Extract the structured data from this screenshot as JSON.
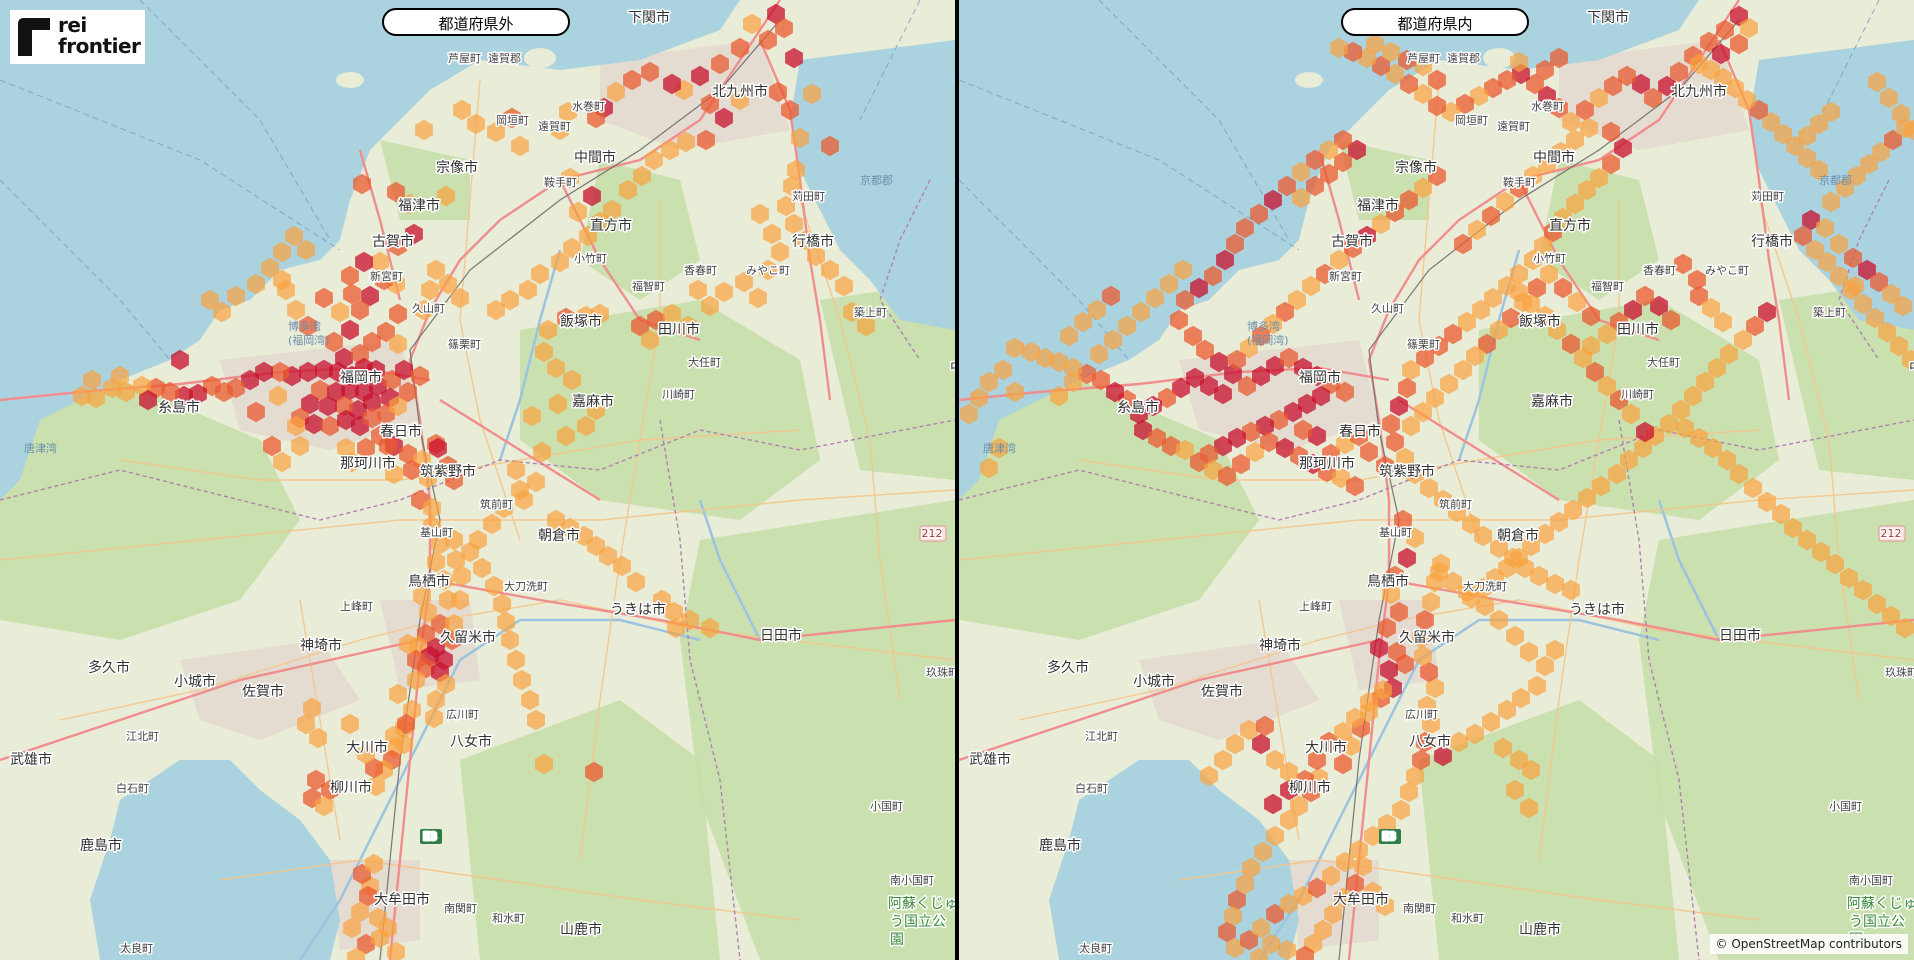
{
  "logo": {
    "line1": "rei",
    "line2": "frontier"
  },
  "panels": [
    {
      "title": "都道府県外"
    },
    {
      "title": "都道府県内"
    }
  ],
  "attribution": "© OpenStreetMap contributors",
  "colors": {
    "sea": "#aad3df",
    "land": "#e9ecd6",
    "forest": "#c6dfaa",
    "urban": "#e2d7cf",
    "road_major": "#f08d8d",
    "road_minor": "#f5c58a",
    "hex_low": "#fff07a",
    "hex_mid": "#f9a33e",
    "hex_high": "#ea5b30",
    "hex_max": "#c8102e"
  },
  "places": [
    {
      "name": "下関市",
      "cls": "city"
    },
    {
      "name": "芦屋町",
      "cls": "town"
    },
    {
      "name": "遠賀郡",
      "cls": "town"
    },
    {
      "name": "水巻町",
      "cls": "town"
    },
    {
      "name": "北九州市",
      "cls": "city"
    },
    {
      "name": "岡垣町",
      "cls": "town"
    },
    {
      "name": "遠賀町",
      "cls": "town"
    },
    {
      "name": "宗像市",
      "cls": "city"
    },
    {
      "name": "中間市",
      "cls": "city"
    },
    {
      "name": "京都郡",
      "cls": "sea"
    },
    {
      "name": "鞍手町",
      "cls": "town"
    },
    {
      "name": "苅田町",
      "cls": "town"
    },
    {
      "name": "福津市",
      "cls": "city"
    },
    {
      "name": "直方市",
      "cls": "city"
    },
    {
      "name": "古賀市",
      "cls": "city"
    },
    {
      "name": "行橋市",
      "cls": "city"
    },
    {
      "name": "小竹町",
      "cls": "town"
    },
    {
      "name": "香春町",
      "cls": "town"
    },
    {
      "name": "みやこ町",
      "cls": "town"
    },
    {
      "name": "新宮町",
      "cls": "town"
    },
    {
      "name": "福智町",
      "cls": "town"
    },
    {
      "name": "久山町",
      "cls": "town"
    },
    {
      "name": "博多湾",
      "cls": "sea"
    },
    {
      "name": "(福岡湾)",
      "cls": "sea"
    },
    {
      "name": "飯塚市",
      "cls": "city"
    },
    {
      "name": "田川市",
      "cls": "city"
    },
    {
      "name": "築上町",
      "cls": "town"
    },
    {
      "name": "篠栗町",
      "cls": "town"
    },
    {
      "name": "大任町",
      "cls": "town"
    },
    {
      "name": "福岡市",
      "cls": "city"
    },
    {
      "name": "糸島市",
      "cls": "city"
    },
    {
      "name": "嘉麻市",
      "cls": "city"
    },
    {
      "name": "川崎町",
      "cls": "town"
    },
    {
      "name": "春日市",
      "cls": "city"
    },
    {
      "name": "唐津湾",
      "cls": "sea"
    },
    {
      "name": "那珂川市",
      "cls": "city"
    },
    {
      "name": "筑紫野市",
      "cls": "city"
    },
    {
      "name": "筑前町",
      "cls": "town"
    },
    {
      "name": "基山町",
      "cls": "town"
    },
    {
      "name": "朝倉市",
      "cls": "city"
    },
    {
      "name": "鳥栖市",
      "cls": "city"
    },
    {
      "name": "大刀洗町",
      "cls": "town"
    },
    {
      "name": "上峰町",
      "cls": "town"
    },
    {
      "name": "うきは市",
      "cls": "city"
    },
    {
      "name": "神埼市",
      "cls": "city"
    },
    {
      "name": "久留米市",
      "cls": "city"
    },
    {
      "name": "日田市",
      "cls": "city"
    },
    {
      "name": "多久市",
      "cls": "city"
    },
    {
      "name": "小城市",
      "cls": "city"
    },
    {
      "name": "佐賀市",
      "cls": "city"
    },
    {
      "name": "玖珠町",
      "cls": "town"
    },
    {
      "name": "広川町",
      "cls": "town"
    },
    {
      "name": "江北町",
      "cls": "town"
    },
    {
      "name": "大川市",
      "cls": "city"
    },
    {
      "name": "八女市",
      "cls": "city"
    },
    {
      "name": "武雄市",
      "cls": "city"
    },
    {
      "name": "白石町",
      "cls": "town"
    },
    {
      "name": "柳川市",
      "cls": "city"
    },
    {
      "name": "小国町",
      "cls": "town"
    },
    {
      "name": "鹿島市",
      "cls": "city"
    },
    {
      "name": "南小国町",
      "cls": "town"
    },
    {
      "name": "大牟田市",
      "cls": "city"
    },
    {
      "name": "南関町",
      "cls": "town"
    },
    {
      "name": "和水町",
      "cls": "town"
    },
    {
      "name": "山鹿市",
      "cls": "city"
    },
    {
      "name": "太良町",
      "cls": "town"
    },
    {
      "name": "阿蘇くじゅ",
      "cls": "park"
    },
    {
      "name": "う国立公",
      "cls": "park"
    },
    {
      "name": "園",
      "cls": "park"
    },
    {
      "name": "E3",
      "cls": "shield"
    },
    {
      "name": "212",
      "cls": "shield-num"
    },
    {
      "name": "中",
      "cls": "city"
    }
  ]
}
